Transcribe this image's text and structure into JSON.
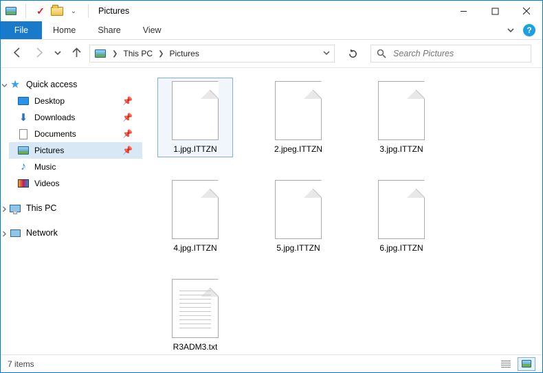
{
  "titlebar": {
    "title": "Pictures"
  },
  "ribbon": {
    "file": "File",
    "tabs": [
      "Home",
      "Share",
      "View"
    ]
  },
  "breadcrumb": {
    "items": [
      "This PC",
      "Pictures"
    ]
  },
  "search": {
    "placeholder": "Search Pictures"
  },
  "sidebar": {
    "quick_access": "Quick access",
    "items": [
      {
        "label": "Desktop",
        "icon": "desktop",
        "pinned": true
      },
      {
        "label": "Downloads",
        "icon": "downloads",
        "pinned": true
      },
      {
        "label": "Documents",
        "icon": "documents",
        "pinned": true
      },
      {
        "label": "Pictures",
        "icon": "pictures",
        "pinned": true,
        "selected": true
      },
      {
        "label": "Music",
        "icon": "music",
        "pinned": false
      },
      {
        "label": "Videos",
        "icon": "videos",
        "pinned": false
      }
    ],
    "this_pc": "This PC",
    "network": "Network"
  },
  "files": [
    {
      "name": "1.jpg.ITTZN",
      "type": "blank",
      "selected": true
    },
    {
      "name": "2.jpeg.ITTZN",
      "type": "blank"
    },
    {
      "name": "3.jpg.ITTZN",
      "type": "blank"
    },
    {
      "name": "4.jpg.ITTZN",
      "type": "blank"
    },
    {
      "name": "5.jpg.ITTZN",
      "type": "blank"
    },
    {
      "name": "6.jpg.ITTZN",
      "type": "blank"
    },
    {
      "name": "R3ADM3.txt",
      "type": "text"
    }
  ],
  "status": {
    "text": "7 items"
  }
}
